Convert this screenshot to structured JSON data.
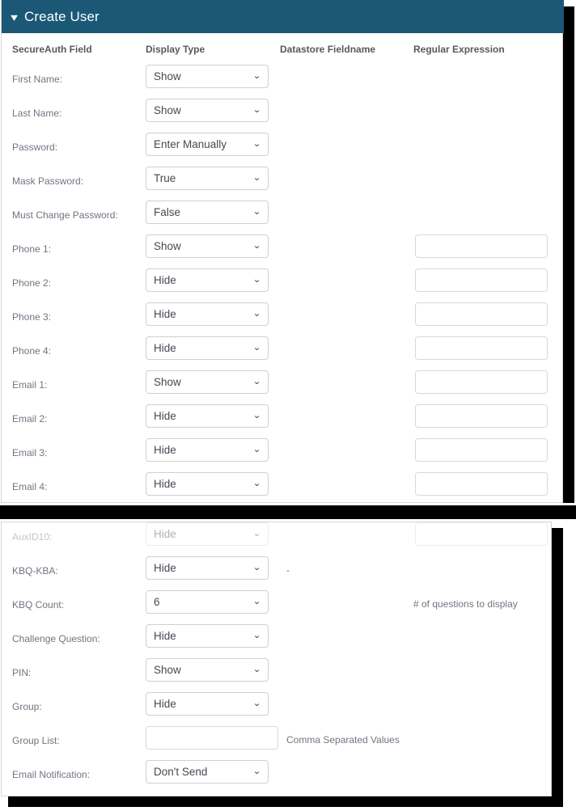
{
  "header": {
    "title": "Create User",
    "collapse_icon": "chevron-down-icon",
    "background_color": "#1a5876",
    "text_color": "#ffffff"
  },
  "columns": [
    "SecureAuth Field",
    "Display Type",
    "Datastore Fieldname",
    "Regular Expression"
  ],
  "panel_top": {
    "rows": [
      {
        "label": "First Name:",
        "display_type": "Show",
        "has_regex": false,
        "regex": ""
      },
      {
        "label": "Last Name:",
        "display_type": "Show",
        "has_regex": false,
        "regex": ""
      },
      {
        "label": "Password:",
        "display_type": "Enter Manually",
        "has_regex": false,
        "regex": ""
      },
      {
        "label": "Mask Password:",
        "display_type": "True",
        "has_regex": false,
        "regex": ""
      },
      {
        "label": "Must Change Password:",
        "display_type": "False",
        "has_regex": false,
        "regex": ""
      },
      {
        "label": "Phone 1:",
        "display_type": "Show",
        "has_regex": true,
        "regex": ""
      },
      {
        "label": "Phone 2:",
        "display_type": "Hide",
        "has_regex": true,
        "regex": ""
      },
      {
        "label": "Phone 3:",
        "display_type": "Hide",
        "has_regex": true,
        "regex": ""
      },
      {
        "label": "Phone 4:",
        "display_type": "Hide",
        "has_regex": true,
        "regex": ""
      },
      {
        "label": "Email 1:",
        "display_type": "Show",
        "has_regex": true,
        "regex": ""
      },
      {
        "label": "Email 2:",
        "display_type": "Hide",
        "has_regex": true,
        "regex": ""
      },
      {
        "label": "Email 3:",
        "display_type": "Hide",
        "has_regex": true,
        "regex": ""
      },
      {
        "label": "Email 4:",
        "display_type": "Hide",
        "has_regex": true,
        "regex": ""
      }
    ]
  },
  "panel_bottom": {
    "rows": [
      {
        "label": "AuxID10:",
        "display_type": "Hide",
        "has_regex": true,
        "regex": "",
        "faded": true,
        "note_mid": "",
        "note_right": ""
      },
      {
        "label": "KBQ-KBA:",
        "display_type": "Hide",
        "has_regex": false,
        "regex": "",
        "faded": false,
        "note_mid": "-",
        "note_right": ""
      },
      {
        "label": "KBQ Count:",
        "display_type": "6",
        "has_regex": false,
        "regex": "",
        "faded": false,
        "note_mid": "",
        "note_right": "# of questions to display"
      },
      {
        "label": "Challenge Question:",
        "display_type": "Hide",
        "has_regex": false,
        "regex": "",
        "faded": false,
        "note_mid": "",
        "note_right": ""
      },
      {
        "label": "PIN:",
        "display_type": "Show",
        "has_regex": false,
        "regex": "",
        "faded": false,
        "note_mid": "",
        "note_right": ""
      },
      {
        "label": "Group:",
        "display_type": "Hide",
        "has_regex": false,
        "regex": "",
        "faded": false,
        "note_mid": "",
        "note_right": ""
      },
      {
        "label": "Group List:",
        "display_type": null,
        "text_value": "",
        "has_text_input": true,
        "faded": false,
        "note_mid": "Comma Separated Values",
        "note_right": ""
      },
      {
        "label": "Email Notification:",
        "display_type": "Don't Send",
        "has_regex": false,
        "regex": "",
        "faded": false,
        "note_mid": "",
        "note_right": ""
      }
    ]
  },
  "icons": {
    "select_caret": "chevron-down-icon"
  },
  "colors": {
    "header_bg": "#1a5876",
    "label_text": "#707580",
    "value_text": "#444a52",
    "border": "#d0d0d0",
    "panel_bg": "#ffffff"
  }
}
